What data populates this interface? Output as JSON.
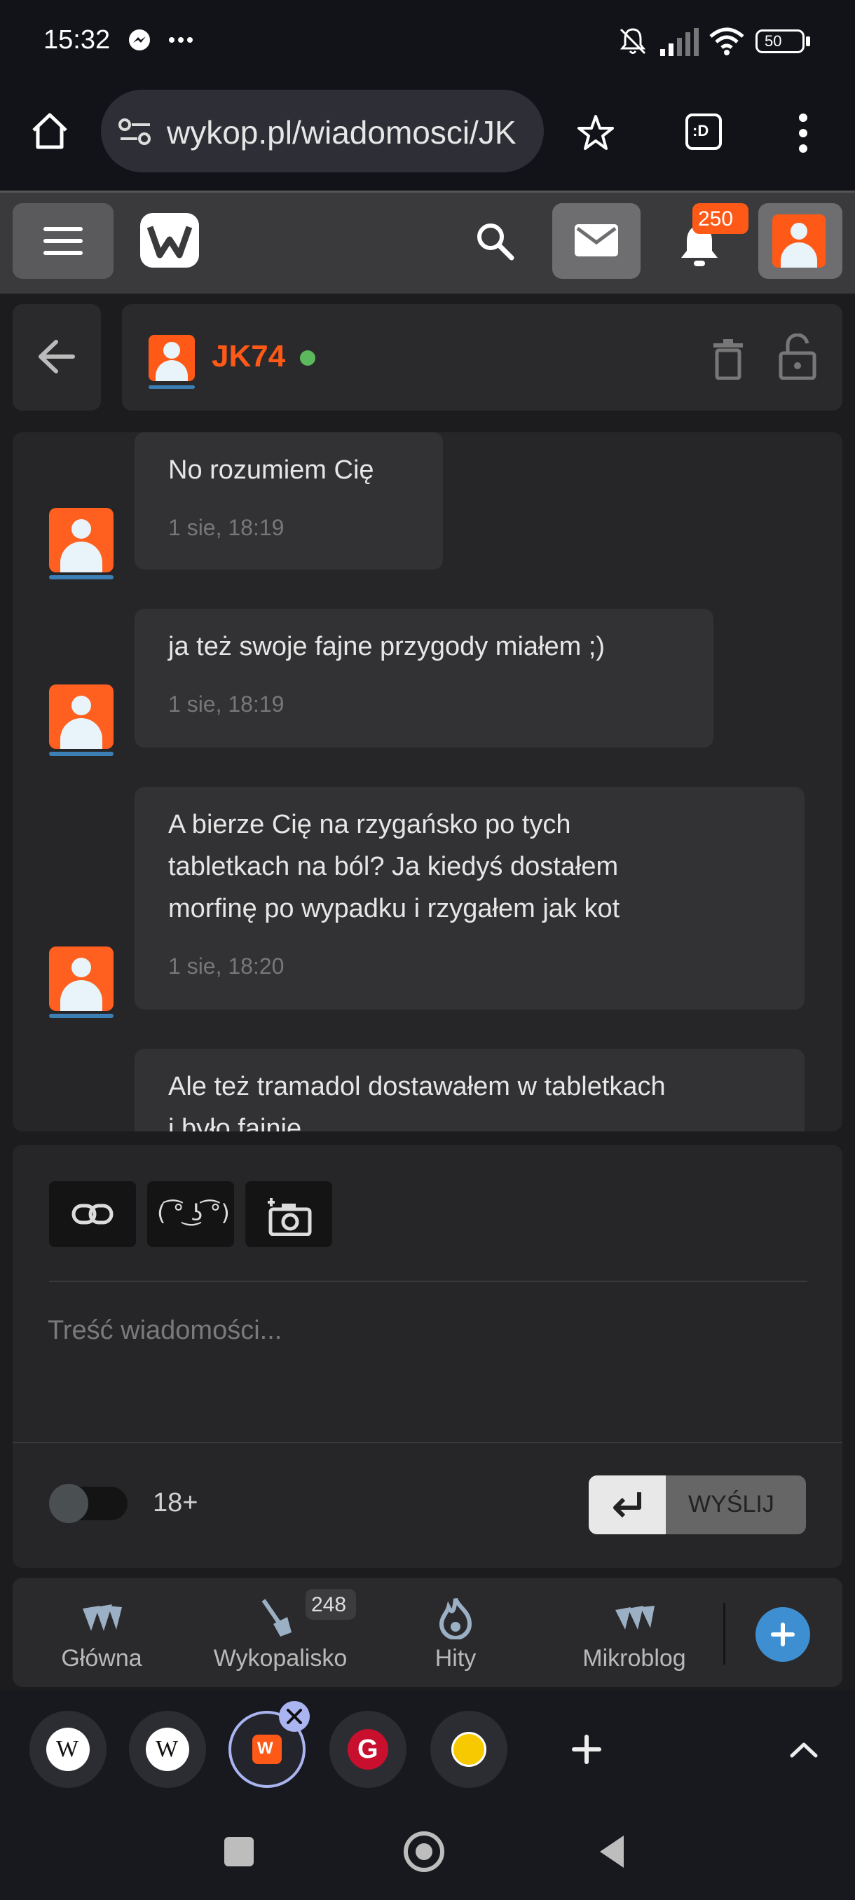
{
  "status_bar": {
    "time": "15:32",
    "battery": "50",
    "icons": [
      "messenger-icon",
      "more-dots-icon",
      "mute-icon",
      "signal-icon",
      "wifi-icon",
      "battery-icon"
    ]
  },
  "browser": {
    "url": "wykop.pl/wiadomosci/JK",
    "tab_count_label": ":D"
  },
  "header": {
    "notification_count": "250"
  },
  "conversation": {
    "username": "JK74",
    "online": true
  },
  "messages": [
    {
      "text": "No rozumiem Cię",
      "time": "1 sie, 18:19"
    },
    {
      "text": "ja też swoje fajne przygody miałem ;)",
      "time": "1 sie, 18:19"
    },
    {
      "text_lines": [
        "A bierze Cię na rzygańsko po tych",
        "tabletkach na ból? Ja kiedyś dostałem",
        "morfinę po wypadku i rzygałem jak kot"
      ],
      "time": "1 sie, 18:20"
    },
    {
      "text_lines": [
        "Ale też tramadol dostawałem w tabletkach",
        "i było fajnie"
      ]
    }
  ],
  "composer": {
    "lenny_label": "( ͡° ͜ʖ ͡°)",
    "placeholder": "Treść wiadomości...",
    "adult_toggle_label": "18+",
    "send_label": "WYŚLIJ"
  },
  "bottom_nav": {
    "items": [
      {
        "label": "Główna"
      },
      {
        "label": "Wykopalisko",
        "badge": "248"
      },
      {
        "label": "Hity"
      },
      {
        "label": "Mikroblog"
      }
    ]
  },
  "tab_strip": {
    "tabs": [
      {
        "glyph": "W"
      },
      {
        "glyph": "W"
      },
      {
        "glyph": "W",
        "active": true
      },
      {
        "glyph": "G"
      },
      {
        "glyph": ""
      }
    ]
  },
  "colors": {
    "accent": "#ff5917",
    "online": "#5cb85c",
    "fab": "#3d8fd1"
  }
}
